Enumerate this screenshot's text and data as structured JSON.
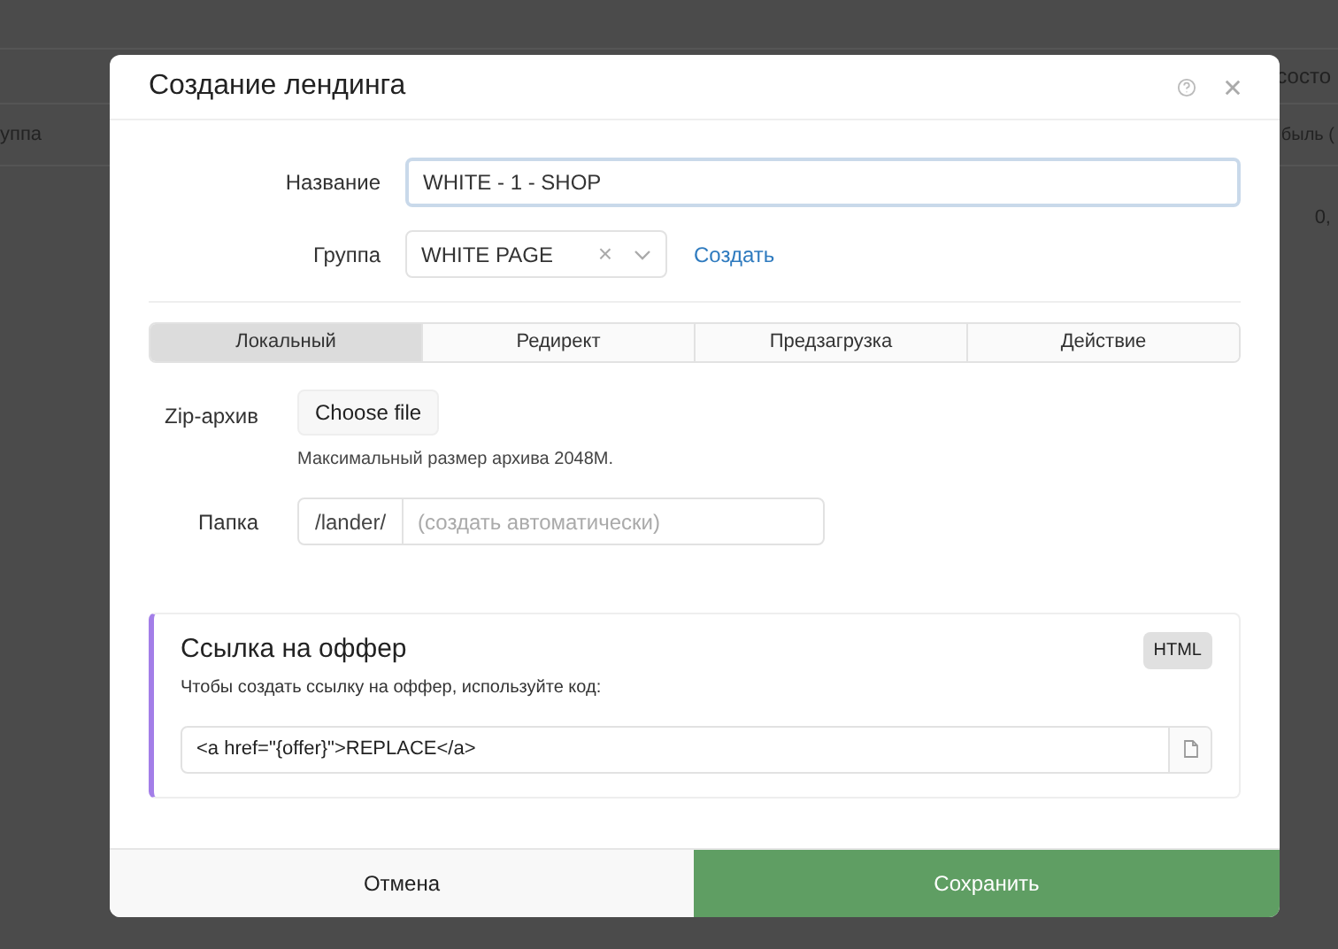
{
  "background": {
    "header_fragment": "состо",
    "column_1": "уппа",
    "column_2": "быль (",
    "cell": "0,"
  },
  "dialog": {
    "title": "Создание лендинга",
    "name_field": {
      "label": "Название",
      "value": "WHITE - 1 - SHOP"
    },
    "group_field": {
      "label": "Группа",
      "value": "WHITE PAGE",
      "clear": "×",
      "create_link": "Создать"
    },
    "tabs": [
      {
        "label": "Локальный",
        "selected": true
      },
      {
        "label": "Редирект",
        "selected": false
      },
      {
        "label": "Предзагрузка",
        "selected": false
      },
      {
        "label": "Действие",
        "selected": false
      }
    ],
    "zip": {
      "label": "Zip-архив",
      "button": "Choose file",
      "hint": "Максимальный размер архива 2048M."
    },
    "folder": {
      "label": "Папка",
      "prefix": "/lander/",
      "placeholder": "(создать автоматически)"
    },
    "offer_link": {
      "title": "Ссылка на оффер",
      "badge": "HTML",
      "description": "Чтобы создать ссылку на оффер, используйте код:",
      "code": "<a href=\"{offer}\">REPLACE</a>"
    },
    "buttons": {
      "cancel": "Отмена",
      "save": "Сохранить"
    }
  }
}
